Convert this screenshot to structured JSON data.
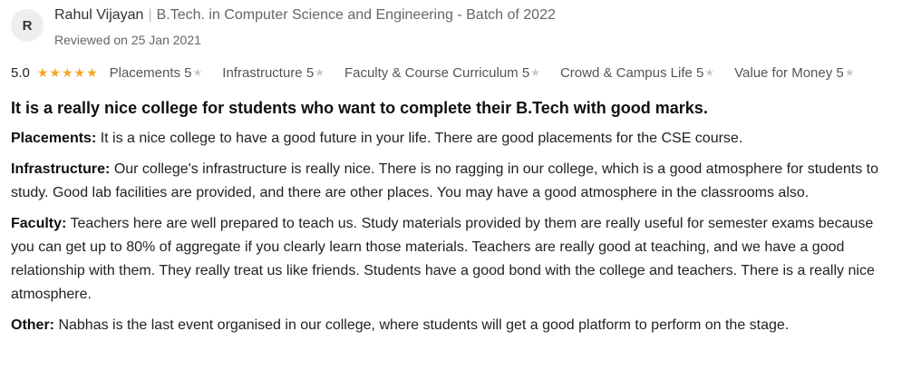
{
  "reviewer": {
    "initial": "R",
    "name": "Rahul Vijayan",
    "separator": "|",
    "program": "B.Tech. in Computer Science and Engineering - Batch of 2022",
    "reviewed_on": "Reviewed on 25 Jan 2021"
  },
  "rating": {
    "overall": "5.0",
    "stars": "★★★★★",
    "star_color": "#f5a623",
    "categories": [
      {
        "label": "Placements",
        "score": "5"
      },
      {
        "label": "Infrastructure",
        "score": "5"
      },
      {
        "label": "Faculty & Course Curriculum",
        "score": "5"
      },
      {
        "label": "Crowd & Campus Life",
        "score": "5"
      },
      {
        "label": "Value for Money",
        "score": "5"
      }
    ]
  },
  "review": {
    "title": "It is a really nice college for students who want to complete their B.Tech with good marks.",
    "sections": [
      {
        "label": "Placements:",
        "text": "It is a nice college to have a good future in your life. There are good placements for the CSE course."
      },
      {
        "label": "Infrastructure:",
        "text": "Our college's infrastructure is really nice. There is no ragging in our college, which is a good atmosphere for students to study. Good lab facilities are provided, and there are other places. You may have a good atmosphere in the classrooms also."
      },
      {
        "label": "Faculty:",
        "text": "Teachers here are well prepared to teach us. Study materials provided by them are really useful for semester exams because you can get up to 80% of aggregate if you clearly learn those materials. Teachers are really good at teaching, and we have a good relationship with them. They really treat us like friends. Students have a good bond with the college and teachers. There is a really nice atmosphere."
      },
      {
        "label": "Other:",
        "text": "Nabhas is the last event organised in our college, where students will get a good platform to perform on the stage."
      }
    ]
  }
}
